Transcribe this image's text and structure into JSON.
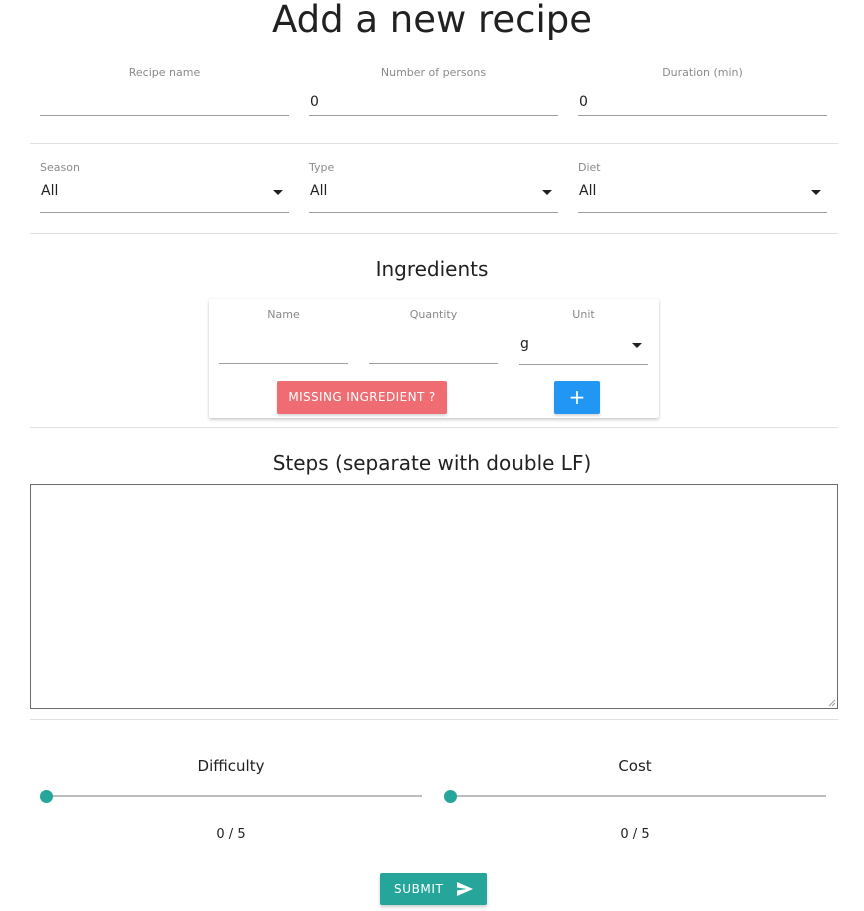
{
  "header": {
    "title": "Add a new recipe"
  },
  "recipe_fields": {
    "name": {
      "label": "Recipe name",
      "value": ""
    },
    "persons": {
      "label": "Number of persons",
      "value": "0"
    },
    "duration": {
      "label": "Duration (min)",
      "value": "0"
    }
  },
  "selects": {
    "season": {
      "label": "Season",
      "value": "All",
      "icon": "dropdown-arrow-icon"
    },
    "type": {
      "label": "Type",
      "value": "All",
      "icon": "dropdown-arrow-icon"
    },
    "diet": {
      "label": "Diet",
      "value": "All",
      "icon": "dropdown-arrow-icon"
    }
  },
  "ingredients": {
    "title": "Ingredients",
    "name_label": "Name",
    "name_value": "",
    "quantity_label": "Quantity",
    "quantity_value": "",
    "unit_label": "Unit",
    "unit_value": "g",
    "missing_button": "MISSING INGREDIENT ?",
    "add_button": "+"
  },
  "steps": {
    "title": "Steps (separate with double LF)",
    "value": ""
  },
  "difficulty": {
    "label": "Difficulty",
    "value": 0,
    "max": 5,
    "display": "0 / 5"
  },
  "cost": {
    "label": "Cost",
    "value": 0,
    "max": 5,
    "display": "0 / 5"
  },
  "submit": {
    "label": "SUBMIT",
    "icon": "send-icon"
  },
  "colors": {
    "accent": "#26a69a",
    "danger": "#ef6c73",
    "primary": "#2196f3"
  }
}
